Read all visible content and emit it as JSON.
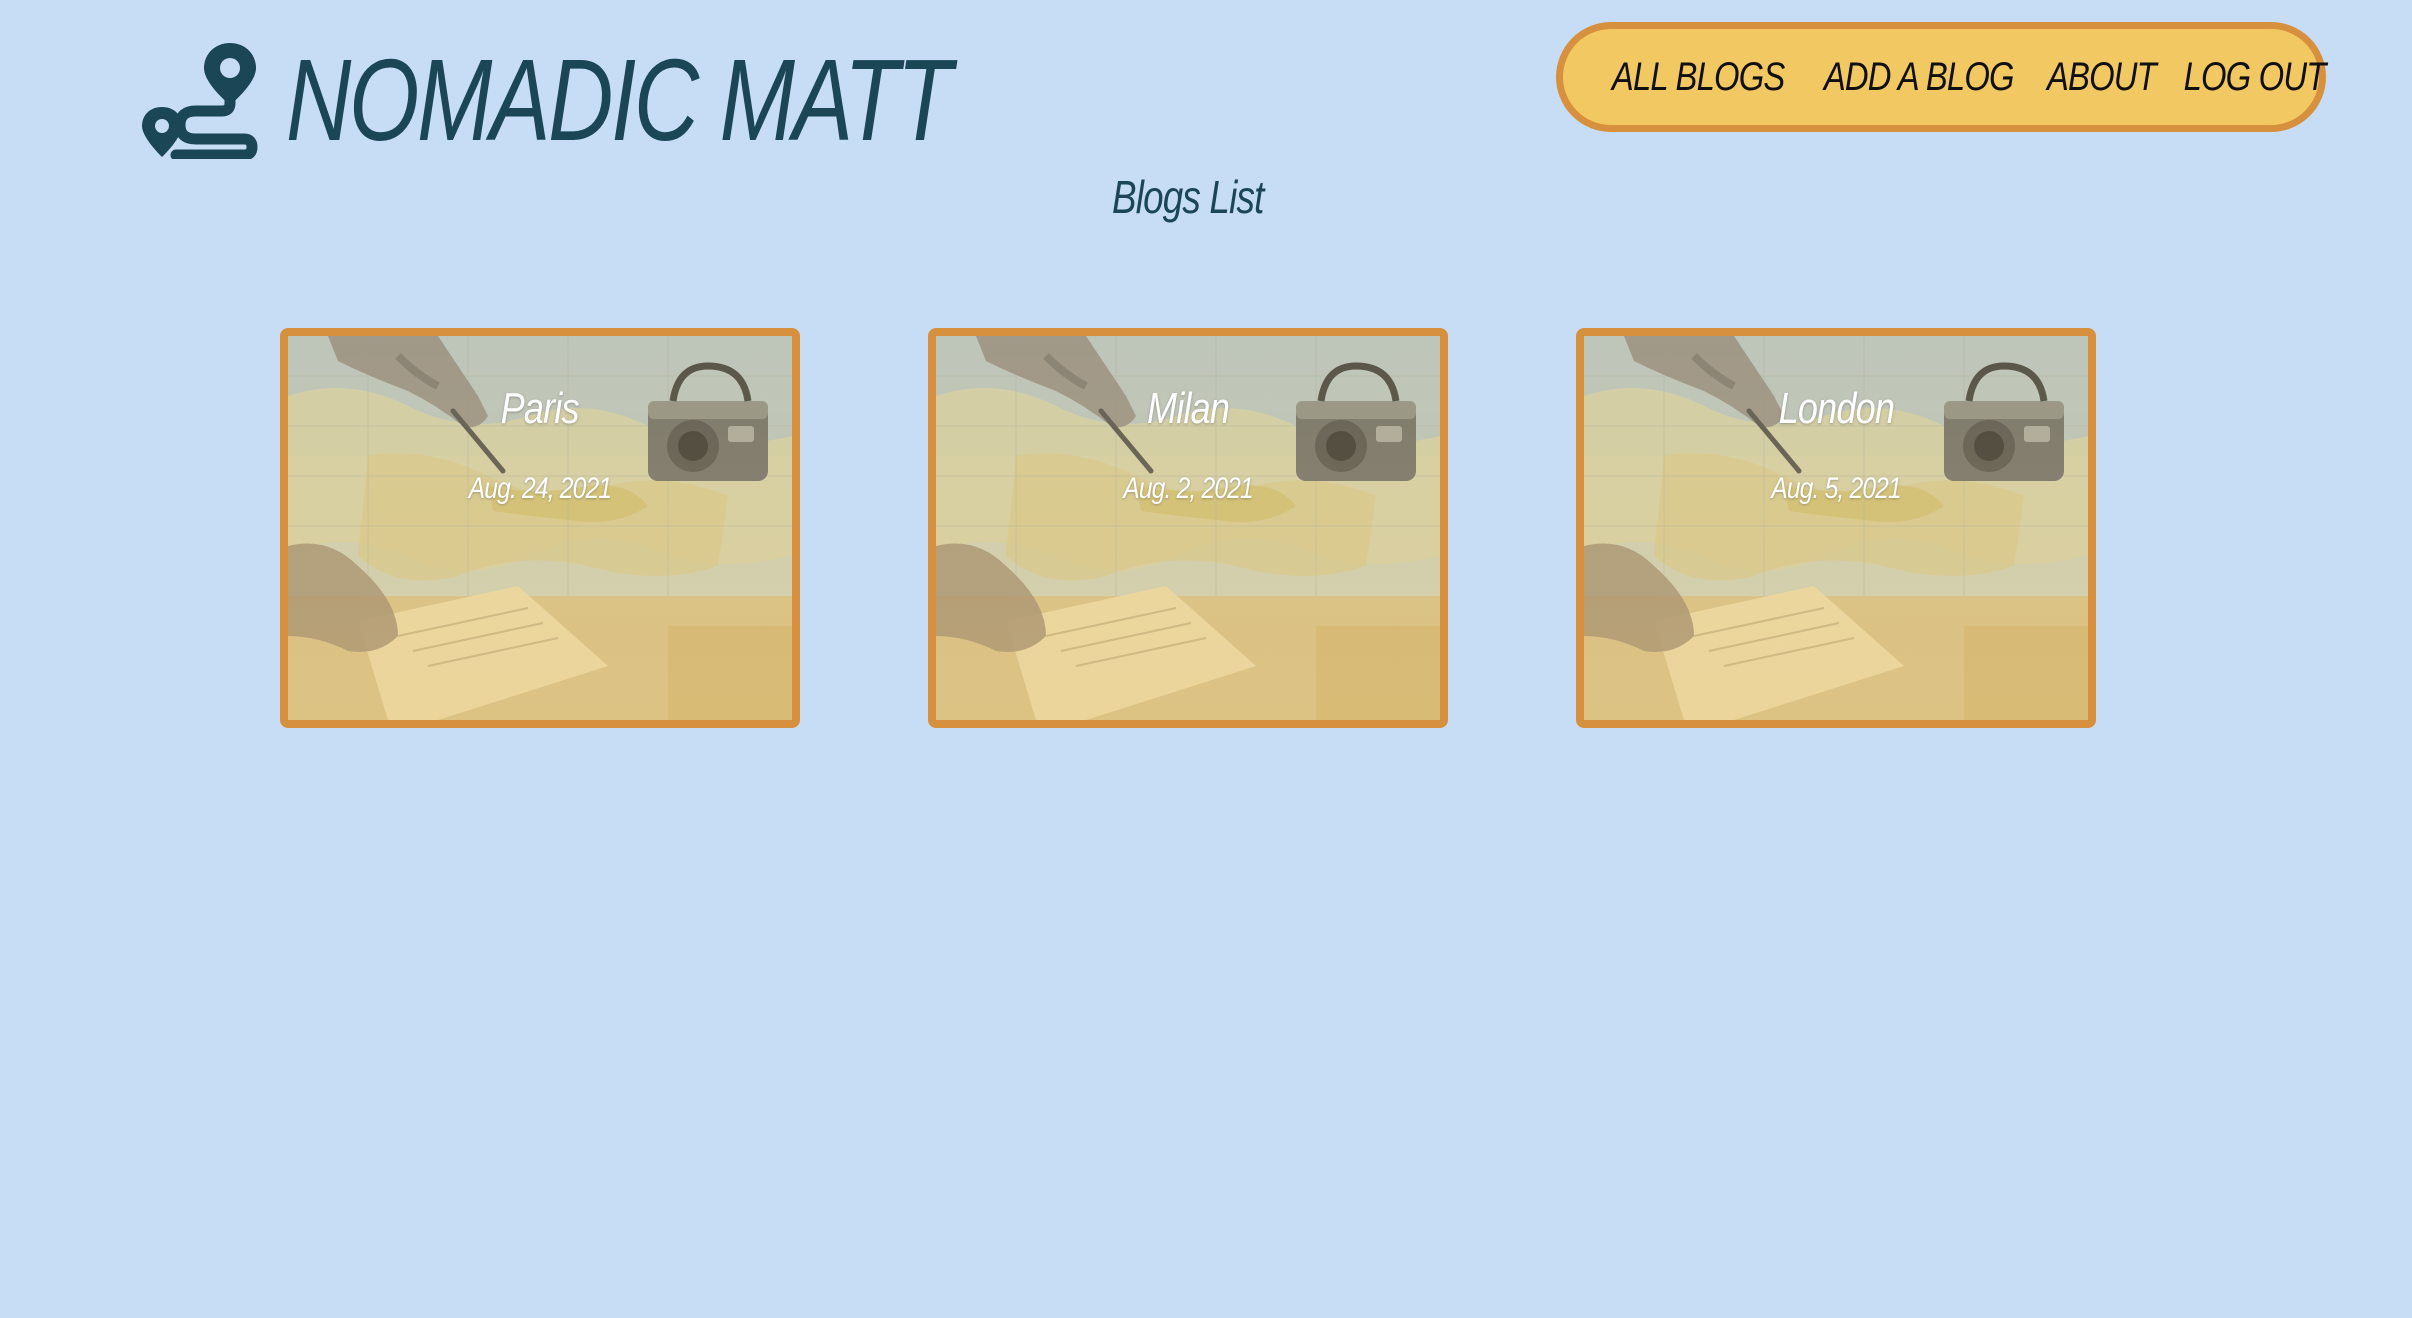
{
  "brand": {
    "title": "NOMADIC MATT",
    "logo_icon": "route-pin-icon"
  },
  "nav": {
    "items": [
      {
        "label": "ALL BLOGS"
      },
      {
        "label": "ADD A BLOG"
      },
      {
        "label": "ABOUT"
      },
      {
        "label": "LOG OUT"
      }
    ]
  },
  "page": {
    "title": "Blogs List"
  },
  "blogs": [
    {
      "title": "Paris",
      "date": "Aug. 24, 2021"
    },
    {
      "title": "Milan",
      "date": "Aug. 2, 2021"
    },
    {
      "title": "London",
      "date": "Aug. 5, 2021"
    }
  ],
  "colors": {
    "background": "#c7ddf6",
    "brand_text": "#1b4656",
    "nav_fill": "#f2c862",
    "nav_border": "#d6903e",
    "card_border": "#d6903e",
    "card_text": "#ffffff"
  }
}
